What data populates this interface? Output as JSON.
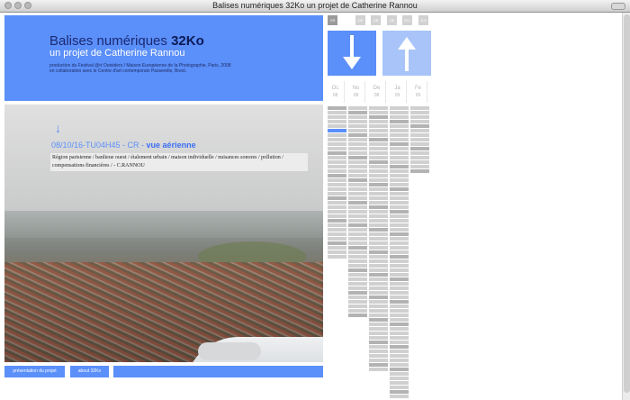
{
  "window": {
    "title": "Balises numériques 32Ko un projet de Catherine Rannou"
  },
  "header": {
    "title_plain": "Balises numériques ",
    "title_bold": "32Ko",
    "subtitle": "un projet de Catherine Rannou",
    "credits_line1": "production du Festival @rt Outsiders / Maison Européenne de la Photographie, Paris, 2008",
    "credits_line2": "en collaboration avec le Centre d'art contemporain Passerelle, Brest."
  },
  "post": {
    "arrow": "↓",
    "caption_id": "08/10/16-TU04H45 - CR - ",
    "caption_title": "vue aérienne",
    "tags": "Région parisienne / banlieue ouest / étalement urbain / maison individuelle / nuisances sonores / pollution / compensations financières / - C.RANNOU"
  },
  "footer": {
    "buttons": [
      "présentation du projet",
      "about 32Ko"
    ]
  },
  "lang_buttons": [
    "CR",
    "DE",
    "GB",
    "DE",
    "SCI",
    "JLS"
  ],
  "months": [
    {
      "m": "Oc",
      "y": "08"
    },
    {
      "m": "No",
      "y": "08"
    },
    {
      "m": "De",
      "y": "08"
    },
    {
      "m": "Ja",
      "y": "09"
    },
    {
      "m": "Fe",
      "y": "09"
    }
  ],
  "colors": {
    "accent": "#5b8ff9",
    "accent_light": "#a8c4f8",
    "cell": "#d0d0d0",
    "cell_dark": "#b3b3b3"
  },
  "icons": {
    "nav_down": "arrow-down-icon",
    "nav_up": "arrow-up-icon"
  }
}
